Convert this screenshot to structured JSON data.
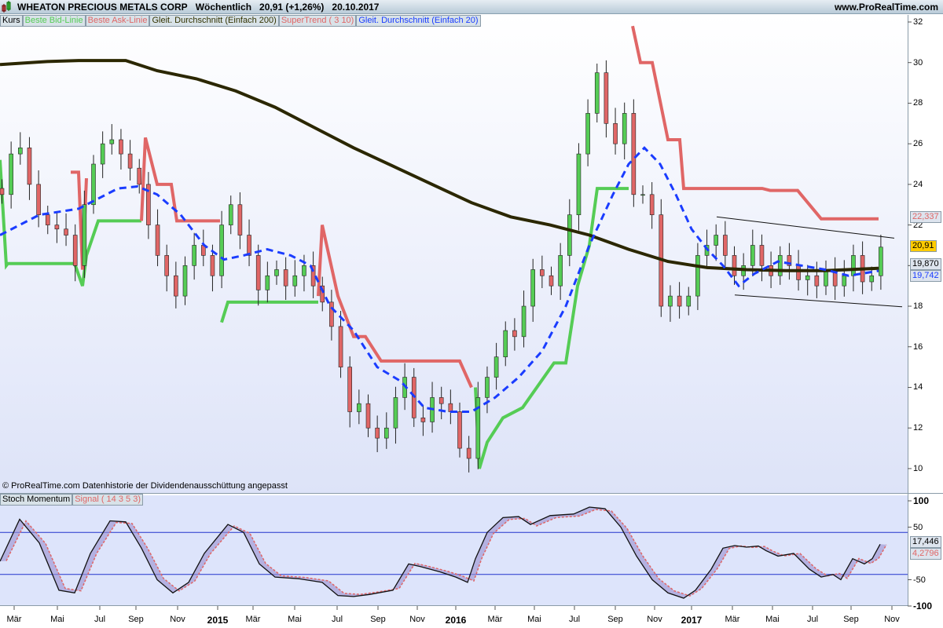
{
  "header": {
    "title": "WHEATON PRECIOUS METALS CORP",
    "interval": "Wöchentlich",
    "price": "20,91 (+1,26%)",
    "date": "20.10.2017",
    "site": "www.ProRealTime.com"
  },
  "legend": [
    {
      "label": "Kurs",
      "color": "#000000"
    },
    {
      "label": "Beste Bid-Linie",
      "color": "#55cc55"
    },
    {
      "label": "Beste Ask-Linie",
      "color": "#e06666"
    },
    {
      "label": "Gleit. Durchschnitt (Einfach 200)",
      "color": "#333300"
    },
    {
      "label": "SuperTrend ( 3 10)",
      "color": "#e06666"
    },
    {
      "label": "Gleit. Durchschnitt (Einfach 20)",
      "color": "#1a3cff"
    }
  ],
  "copyright": "© ProRealTime.com  Datenhistorie der Dividendenausschüttung angepasst",
  "stoch_legend": [
    {
      "label": "Stoch Momentum",
      "color": "#000000"
    },
    {
      "label": "Signal ( 14 3 5 3)",
      "color": "#e06666"
    }
  ],
  "badges": {
    "ask": "22,337",
    "last": "20,91",
    "sma200": "19,870",
    "sma20": "19,742",
    "stoch": "17,446",
    "signal": "4,2796"
  },
  "chart_data": [
    {
      "type": "candlestick",
      "title": "WHEATON PRECIOUS METALS CORP",
      "ylim": [
        9,
        32.2
      ],
      "yticks": [
        10,
        12,
        14,
        16,
        18,
        20,
        22,
        24,
        26,
        28,
        30,
        32
      ],
      "x_labels": [
        "Mär",
        "Mai",
        "Jul",
        "Sep",
        "Nov",
        "2015",
        "Mär",
        "Mai",
        "Jul",
        "Sep",
        "Nov",
        "2016",
        "Mär",
        "Mai",
        "Jul",
        "Sep",
        "Nov",
        "2017",
        "Mär",
        "Mai",
        "Jul",
        "Sep",
        "Nov"
      ],
      "x_label_bold": [
        5,
        11,
        17
      ],
      "closes_biweekly": [
        23.5,
        25.5,
        25.8,
        24,
        22.5,
        22,
        21.8,
        21.5,
        20,
        23,
        25,
        26,
        26.2,
        25.5,
        24.8,
        24,
        22,
        20.5,
        19.5,
        18.5,
        20,
        21,
        20.5,
        19.5,
        22,
        23,
        21.5,
        20.5,
        18.8,
        19.5,
        19.8,
        19,
        19.5,
        20,
        19,
        18.2,
        17,
        15,
        12.8,
        13.2,
        12,
        11.5,
        12,
        13.5,
        14.5,
        12.5,
        12.3,
        13.5,
        13.2,
        12.8,
        11,
        10.5,
        13.5,
        14.5,
        15.5,
        16.8,
        16.5,
        18,
        19.8,
        19.5,
        19,
        20.5,
        22.5,
        25.5,
        27.5,
        29.5,
        27,
        26,
        27.5,
        23.5,
        23.5,
        22.5,
        18,
        18.5,
        18,
        18.5,
        20.5,
        21,
        21.5,
        20.5,
        19.5,
        20,
        21,
        20,
        19.5,
        20.5,
        20,
        19.3,
        19.5,
        19,
        19.8,
        19,
        19.5,
        20.5,
        19.2,
        19.5,
        20.91
      ],
      "sma200": [
        [
          0,
          29.9
        ],
        [
          6,
          30.05
        ],
        [
          10,
          30.1
        ],
        [
          16,
          30.1
        ],
        [
          20,
          29.6
        ],
        [
          25,
          29.2
        ],
        [
          30,
          28.6
        ],
        [
          35,
          27.8
        ],
        [
          40,
          26.8
        ],
        [
          45,
          25.8
        ],
        [
          50,
          24.9
        ],
        [
          55,
          24
        ],
        [
          60,
          23.1
        ],
        [
          65,
          22.4
        ],
        [
          70,
          22
        ],
        [
          75,
          21.5
        ],
        [
          80,
          20.8
        ],
        [
          85,
          20.2
        ],
        [
          90,
          19.9
        ],
        [
          95,
          19.8
        ],
        [
          100,
          19.75
        ],
        [
          105,
          19.75
        ],
        [
          111.8,
          19.87
        ]
      ],
      "sma20": [
        [
          0,
          21.5
        ],
        [
          5,
          22.5
        ],
        [
          10,
          22.8
        ],
        [
          15,
          23.8
        ],
        [
          17.5,
          23.9
        ],
        [
          20,
          23.5
        ],
        [
          23,
          22.5
        ],
        [
          26,
          21
        ],
        [
          28.5,
          20.3
        ],
        [
          31,
          20.5
        ],
        [
          34,
          20.8
        ],
        [
          37,
          20.5
        ],
        [
          39.5,
          20
        ],
        [
          42,
          18
        ],
        [
          45,
          16.8
        ],
        [
          48,
          15
        ],
        [
          51,
          14.3
        ],
        [
          54,
          13
        ],
        [
          57,
          12.8
        ],
        [
          60,
          12.8
        ],
        [
          63,
          13.5
        ],
        [
          66,
          14.5
        ],
        [
          69,
          15.8
        ],
        [
          72,
          18
        ],
        [
          75,
          21
        ],
        [
          78,
          23.5
        ],
        [
          80,
          25
        ],
        [
          82,
          25.8
        ],
        [
          84,
          25
        ],
        [
          86,
          23.5
        ],
        [
          88,
          21.8
        ],
        [
          90,
          20.8
        ],
        [
          92,
          20
        ],
        [
          94,
          19
        ],
        [
          96,
          19.6
        ],
        [
          99,
          20.2
        ],
        [
          102,
          20
        ],
        [
          105,
          19.8
        ],
        [
          108,
          19.5
        ],
        [
          111.8,
          19.74
        ]
      ],
      "supertrend_bid": [
        [
          [
            0,
            25.2
          ],
          [
            0.8,
            20
          ],
          [
            1,
            20.1
          ],
          [
            9,
            20.1
          ],
          [
            9.5,
            20.1
          ],
          [
            10.5,
            19
          ],
          [
            11,
            20.5
          ],
          [
            12.5,
            22.2
          ],
          [
            18,
            22.2
          ]
        ],
        [
          [
            28.2,
            17.2
          ],
          [
            29,
            18.2
          ],
          [
            40.5,
            18.2
          ]
        ],
        [
          [
            60.5,
            14
          ],
          [
            61,
            10
          ],
          [
            62,
            11.3
          ],
          [
            64,
            12.5
          ],
          [
            66.5,
            13
          ],
          [
            70.5,
            15.2
          ],
          [
            72,
            15.2
          ],
          [
            73.5,
            19
          ],
          [
            75,
            21
          ],
          [
            76,
            23.8
          ],
          [
            80,
            23.8
          ]
        ]
      ],
      "supertrend_ask": [
        [
          [
            9,
            24.6
          ],
          [
            10,
            24.6
          ],
          [
            10.5,
            19.8
          ],
          [
            11,
            24.3
          ]
        ],
        [
          [
            18,
            22.2
          ],
          [
            18.5,
            26.3
          ],
          [
            20,
            24
          ],
          [
            21.8,
            24
          ],
          [
            22.5,
            22.2
          ],
          [
            28,
            22.2
          ]
        ],
        [
          [
            40.5,
            18.5
          ],
          [
            41,
            22
          ],
          [
            43,
            18.5
          ],
          [
            45,
            16.5
          ],
          [
            46.5,
            16.5
          ],
          [
            48.5,
            15.3
          ],
          [
            58.5,
            15.3
          ],
          [
            60,
            14
          ]
        ],
        [
          [
            80.5,
            31.8
          ],
          [
            81.5,
            30
          ],
          [
            83,
            30
          ],
          [
            85,
            26.2
          ],
          [
            86.5,
            26.2
          ],
          [
            87,
            23.8
          ],
          [
            97,
            23.8
          ],
          [
            98,
            23.7
          ],
          [
            101.5,
            23.7
          ],
          [
            103,
            23
          ],
          [
            104.5,
            22.3
          ],
          [
            111.8,
            22.3
          ]
        ]
      ],
      "channel": {
        "upper": [
          [
            91.2,
            22.4
          ],
          [
            113.8,
            21.35
          ]
        ],
        "lower": [
          [
            93.5,
            18.55
          ],
          [
            114.8,
            17.97
          ]
        ]
      }
    },
    {
      "type": "line",
      "title": "Stoch Momentum",
      "ylim": [
        -110,
        110
      ],
      "yticks": [
        100,
        50,
        -50,
        -100
      ],
      "levels": [
        40,
        -40
      ],
      "stoch": [
        [
          0,
          -15
        ],
        [
          2.5,
          65
        ],
        [
          5,
          20
        ],
        [
          7.5,
          -70
        ],
        [
          9.5,
          -75
        ],
        [
          11.5,
          0
        ],
        [
          14,
          62
        ],
        [
          16,
          60
        ],
        [
          18,
          10
        ],
        [
          20,
          -50
        ],
        [
          22,
          -75
        ],
        [
          24,
          -55
        ],
        [
          26,
          0
        ],
        [
          29,
          55
        ],
        [
          31,
          40
        ],
        [
          33,
          -20
        ],
        [
          35,
          -45
        ],
        [
          38,
          -48
        ],
        [
          41,
          -55
        ],
        [
          43,
          -80
        ],
        [
          45,
          -82
        ],
        [
          47,
          -78
        ],
        [
          50,
          -70
        ],
        [
          52,
          -20
        ],
        [
          53.5,
          -25
        ],
        [
          56,
          -35
        ],
        [
          58,
          -45
        ],
        [
          59.5,
          -55
        ],
        [
          60.5,
          -10
        ],
        [
          62,
          40
        ],
        [
          64,
          68
        ],
        [
          66,
          70
        ],
        [
          67.5,
          55
        ],
        [
          70,
          72
        ],
        [
          73,
          75
        ],
        [
          75,
          88
        ],
        [
          77,
          85
        ],
        [
          79,
          50
        ],
        [
          81,
          -5
        ],
        [
          83,
          -50
        ],
        [
          85,
          -75
        ],
        [
          87,
          -85
        ],
        [
          88.5,
          -70
        ],
        [
          90.5,
          -30
        ],
        [
          92,
          10
        ],
        [
          93.5,
          15
        ],
        [
          95,
          12
        ],
        [
          96.5,
          14
        ],
        [
          97.5,
          5
        ],
        [
          99,
          -5
        ],
        [
          101,
          0
        ],
        [
          103,
          -30
        ],
        [
          104.5,
          -45
        ],
        [
          106,
          -40
        ],
        [
          107,
          -50
        ],
        [
          108.5,
          -10
        ],
        [
          110,
          -20
        ],
        [
          111,
          -10
        ],
        [
          112,
          17.4
        ]
      ],
      "signal_lag": 0.8
    }
  ]
}
